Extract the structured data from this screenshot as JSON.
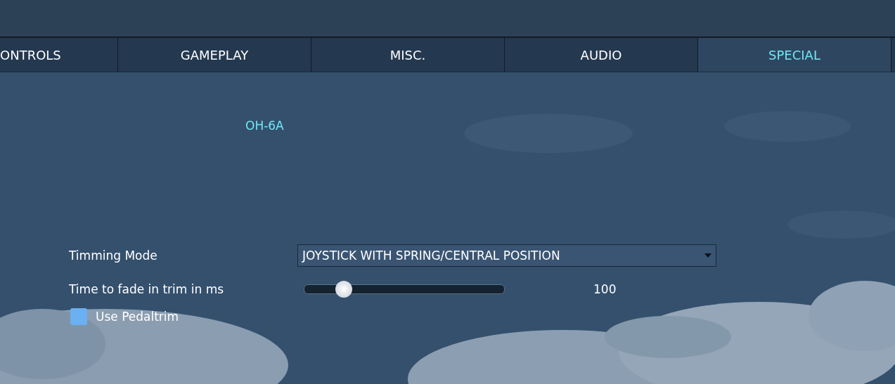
{
  "tabs": [
    {
      "label": "ONTROLS",
      "selected": false
    },
    {
      "label": "GAMEPLAY",
      "selected": false
    },
    {
      "label": "MISC.",
      "selected": false
    },
    {
      "label": "AUDIO",
      "selected": false
    },
    {
      "label": "SPECIAL",
      "selected": true
    }
  ],
  "aircraft": "OH-6A",
  "settings": [
    {
      "kind": "dropdown",
      "label": "Timming Mode",
      "value": "JOYSTICK WITH SPRING/CENTRAL POSITION"
    },
    {
      "kind": "slider",
      "label": "Time to fade in trim in ms",
      "level": 0.2,
      "reading": "100"
    },
    {
      "kind": "checkbox",
      "label": "Use Pedaltrim",
      "checked": false
    }
  ]
}
